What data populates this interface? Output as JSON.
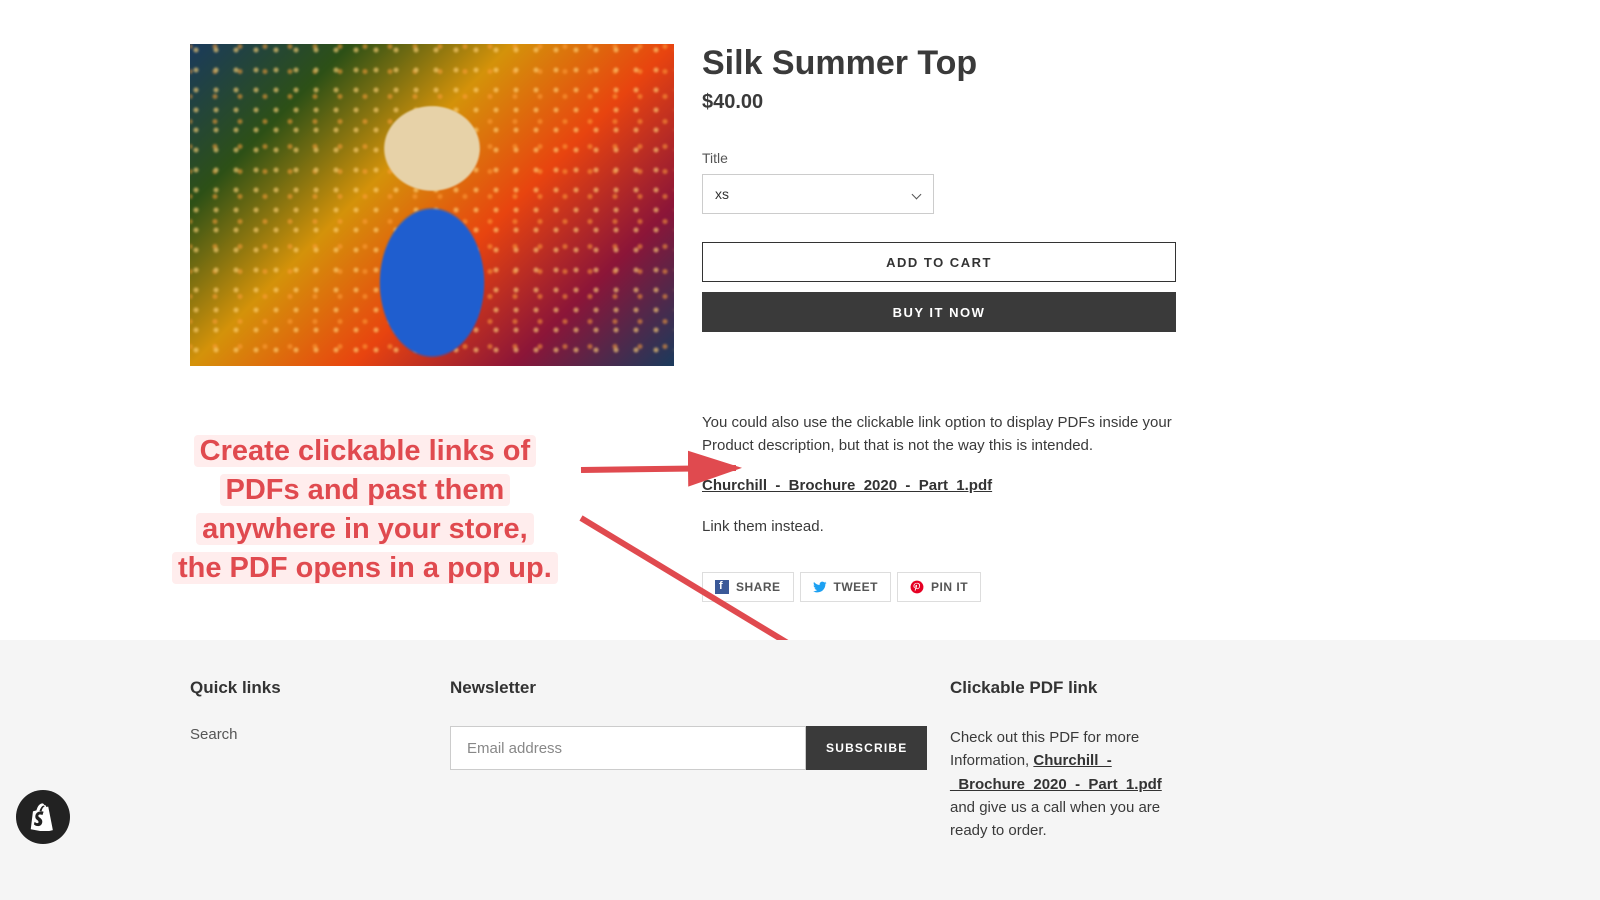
{
  "product": {
    "title": "Silk Summer Top",
    "price": "$40.00",
    "option_label": "Title",
    "option_value": "xs",
    "add_to_cart": "ADD TO CART",
    "buy_now": "BUY IT NOW",
    "desc_intro": "You could also use the clickable link option to display PDFs inside your Product description, but that is not the way this is intended.",
    "pdf_name": "Churchill_-_Brochure_2020_-_Part_1.pdf",
    "desc_after": "Link them instead."
  },
  "share": {
    "facebook": "SHARE",
    "twitter": "TWEET",
    "pinterest": "PIN IT"
  },
  "callout": {
    "l1": "Create clickable links of",
    "l2": "PDFs and past them",
    "l3": "anywhere in your store,",
    "l4": "the PDF opens in a pop up."
  },
  "footer": {
    "quick_links_head": "Quick links",
    "search": "Search",
    "newsletter_head": "Newsletter",
    "email_placeholder": "Email address",
    "subscribe": "SUBSCRIBE",
    "pdf_head": "Clickable PDF link",
    "pdf_text_before": "Check out this PDF for more Information, ",
    "pdf_name": "Churchill_-_Brochure_2020_-_Part_1.pdf",
    "pdf_text_after": " and give us a call when you are ready to order."
  }
}
